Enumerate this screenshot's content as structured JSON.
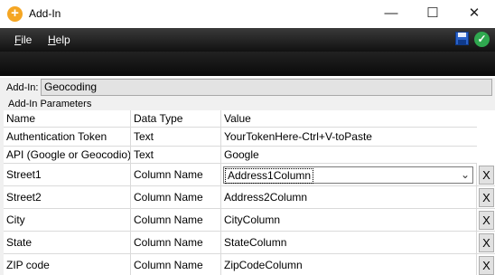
{
  "window": {
    "title": "Add-In",
    "minimize": "—",
    "maximize": "☐",
    "close": "✕",
    "icon": "+"
  },
  "menu": {
    "file_underlined": "F",
    "file_rest": "ile",
    "help_underlined": "H",
    "help_rest": "elp"
  },
  "toolbar": {
    "ok_icon_glyph": "✓"
  },
  "addin": {
    "label": "Add-In:",
    "value": "Geocoding"
  },
  "params": {
    "section_label": "Add-In Parameters",
    "headers": [
      "Name",
      "Data Type",
      "Value"
    ],
    "rows": [
      {
        "name": "Authentication Token",
        "type": "Text",
        "value": "YourTokenHere-Ctrl+V-toPaste"
      },
      {
        "name": "API (Google or Geocodio)",
        "type": "Text",
        "value": "Google"
      },
      {
        "name": "Street1",
        "type": "Column Name",
        "value": "Address1Column",
        "remove": "X"
      },
      {
        "name": "Street2",
        "type": "Column Name",
        "value": "Address2Column",
        "remove": "X"
      },
      {
        "name": "City",
        "type": "Column Name",
        "value": "CityColumn",
        "remove": "X"
      },
      {
        "name": "State",
        "type": "Column Name",
        "value": "StateColumn",
        "remove": "X"
      },
      {
        "name": "ZIP code",
        "type": "Column Name",
        "value": "ZipCodeColumn",
        "remove": "X"
      }
    ]
  }
}
